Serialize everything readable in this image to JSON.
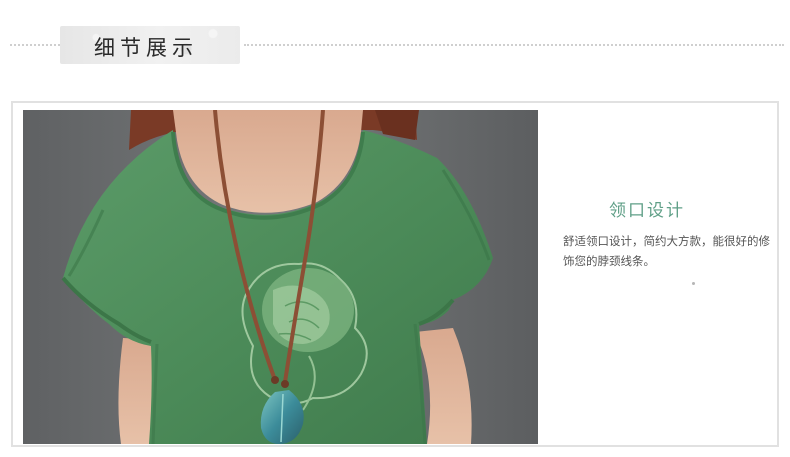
{
  "header": {
    "title": "细节展示"
  },
  "detail": {
    "title": "领口设计",
    "description": "舒适领口设计，简约大方款，能很好的修饰您的脖颈线条。"
  },
  "colors": {
    "accent": "#5f9f87",
    "garment": "#4f8d5d",
    "background": "#6d6f70"
  }
}
